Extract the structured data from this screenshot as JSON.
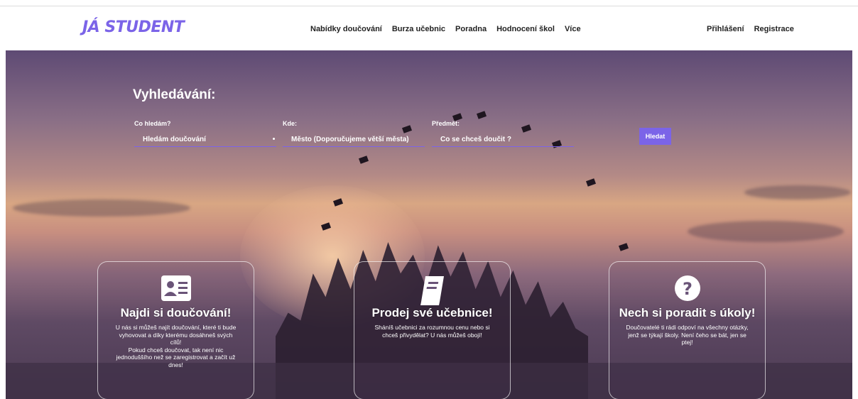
{
  "header": {
    "logo": "JÁ STUDENT",
    "nav": [
      "Nabídky doučování",
      "Burza učebnic",
      "Poradna",
      "Hodnocení škol",
      "Více"
    ],
    "auth": [
      "Přihlášení",
      "Registrace"
    ]
  },
  "search": {
    "title": "Vyhledávání:",
    "fields": [
      {
        "label": "Co hledám?",
        "value": "Hledám doučování"
      },
      {
        "label": "Kde:",
        "value": "Město (Doporučujeme větší města)"
      },
      {
        "label": "Předmět:",
        "value": "Co se chceš doučit ?"
      }
    ],
    "button": "Hledat"
  },
  "cards": [
    {
      "icon": "id-card-icon",
      "title": "Najdi si doučování!",
      "text": "U nás si můžeš najít doučování, které ti bude\nvyhovovat a díky kterému dosáhneš svých\ncílů!\nPokud chceš doučovat, tak není nic\njednoduššího než se zaregistrovat a začít už\ndnes!"
    },
    {
      "icon": "book-icon",
      "title": "Prodej své učebnice!",
      "text": "Sháníš učebnici za rozumnou cenu nebo si\nchceš přivydělat? U nás můžeš obojí!"
    },
    {
      "icon": "question-circle-icon",
      "title": "Nech si poradit s úkoly!",
      "text": "Doučovatelé ti rádi odpoví na všechny otázky,\njenž se týkají školy. Není čeho se bát, jen se\nptej!"
    }
  ],
  "colors": {
    "accent": "#7b64e8"
  }
}
